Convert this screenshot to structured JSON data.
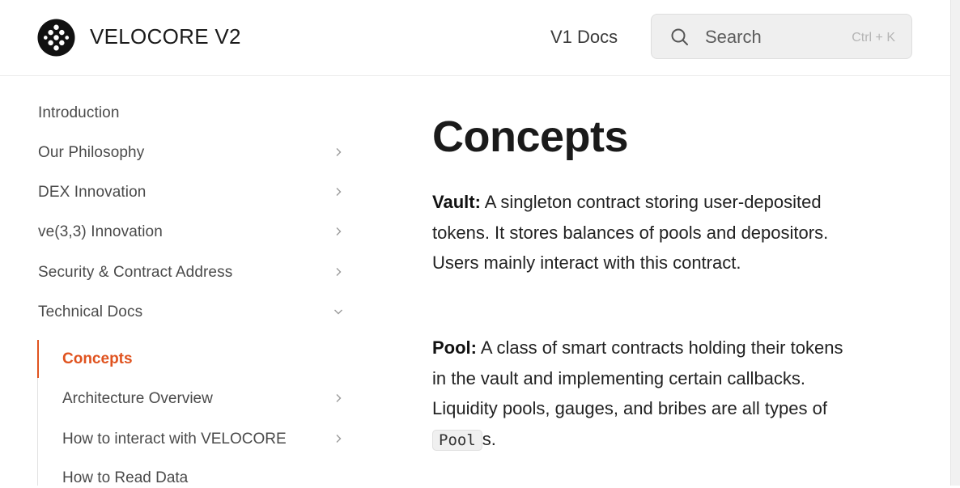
{
  "header": {
    "brand": "VELOCORE V2",
    "v1_link": "V1 Docs",
    "search_placeholder": "Search",
    "search_shortcut": "Ctrl + K"
  },
  "sidebar": {
    "items": [
      {
        "label": "Introduction",
        "has_chevron": false
      },
      {
        "label": "Our Philosophy",
        "has_chevron": true
      },
      {
        "label": "DEX Innovation",
        "has_chevron": true
      },
      {
        "label": "ve(3,3) Innovation",
        "has_chevron": true
      },
      {
        "label": "Security & Contract Address",
        "has_chevron": true
      },
      {
        "label": "Technical Docs",
        "has_chevron": true,
        "expanded": true
      }
    ],
    "sub_items": [
      {
        "label": "Concepts",
        "active": true
      },
      {
        "label": "Architecture Overview",
        "has_chevron": true
      },
      {
        "label": "How to interact with VELOCORE",
        "has_chevron": true
      },
      {
        "label": "How to Read Data"
      }
    ]
  },
  "main": {
    "title": "Concepts",
    "vault_term": "Vault:",
    "vault_text": " A singleton contract storing user-deposited tokens. It stores balances of pools and depositors. Users mainly interact with this contract.",
    "pool_term": "Pool:",
    "pool_text": " A class of smart contracts holding their tokens in the vault and implementing certain callbacks. Liquidity pools, gauges, and bribes are all types of ",
    "pool_code": "Pool",
    "pool_suffix": "s."
  },
  "colors": {
    "accent": "#e0531f",
    "text": "#1f1f1f",
    "sidebar_text": "#4a4a4a"
  }
}
